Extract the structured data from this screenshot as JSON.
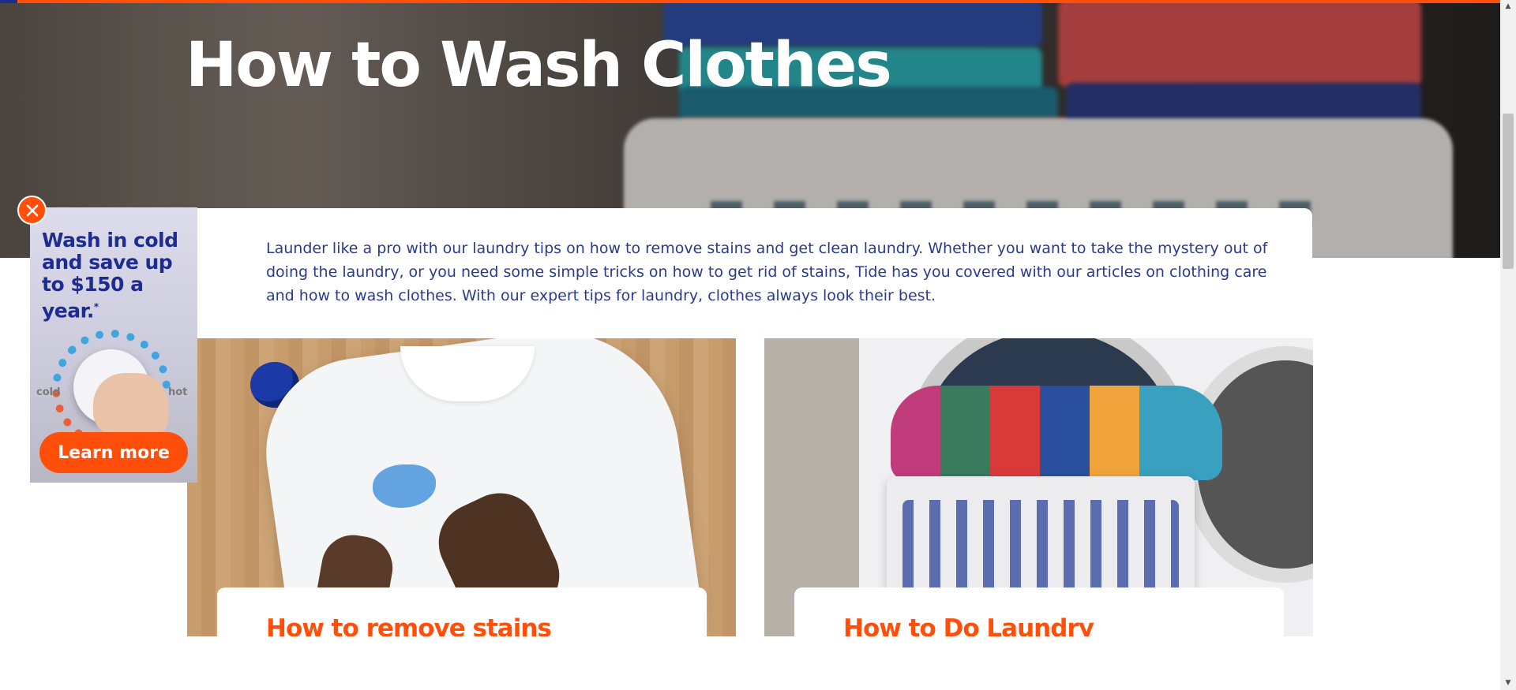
{
  "page": {
    "title": "How to Wash Clothes",
    "intro": "Launder like a pro with our laundry tips on how to remove stains and get clean laundry. Whether you want to take the mystery out of doing the laundry, or you need some simple tricks on how to get rid of stains, Tide has you covered with our articles on clothing care and how to wash clothes. With our expert tips for laundry, clothes always look their best."
  },
  "articles": [
    {
      "title": "How to remove stains",
      "image": "stained-white-shirt"
    },
    {
      "title": "How to Do Laundry",
      "image": "laundry-basket-washer"
    }
  ],
  "ad": {
    "headline": "Wash in cold and save up to $150 a year.",
    "asterisk": "*",
    "cold_label": "cold",
    "hot_label": "hot",
    "cta": "Learn more",
    "close_icon": "close-icon"
  },
  "colors": {
    "brand_orange": "#ff4f0b",
    "brand_blue": "#1f2c8f",
    "text_blue": "#2a3a8f"
  },
  "scrollbar": {
    "up_glyph": "▲",
    "down_glyph": "▼"
  }
}
